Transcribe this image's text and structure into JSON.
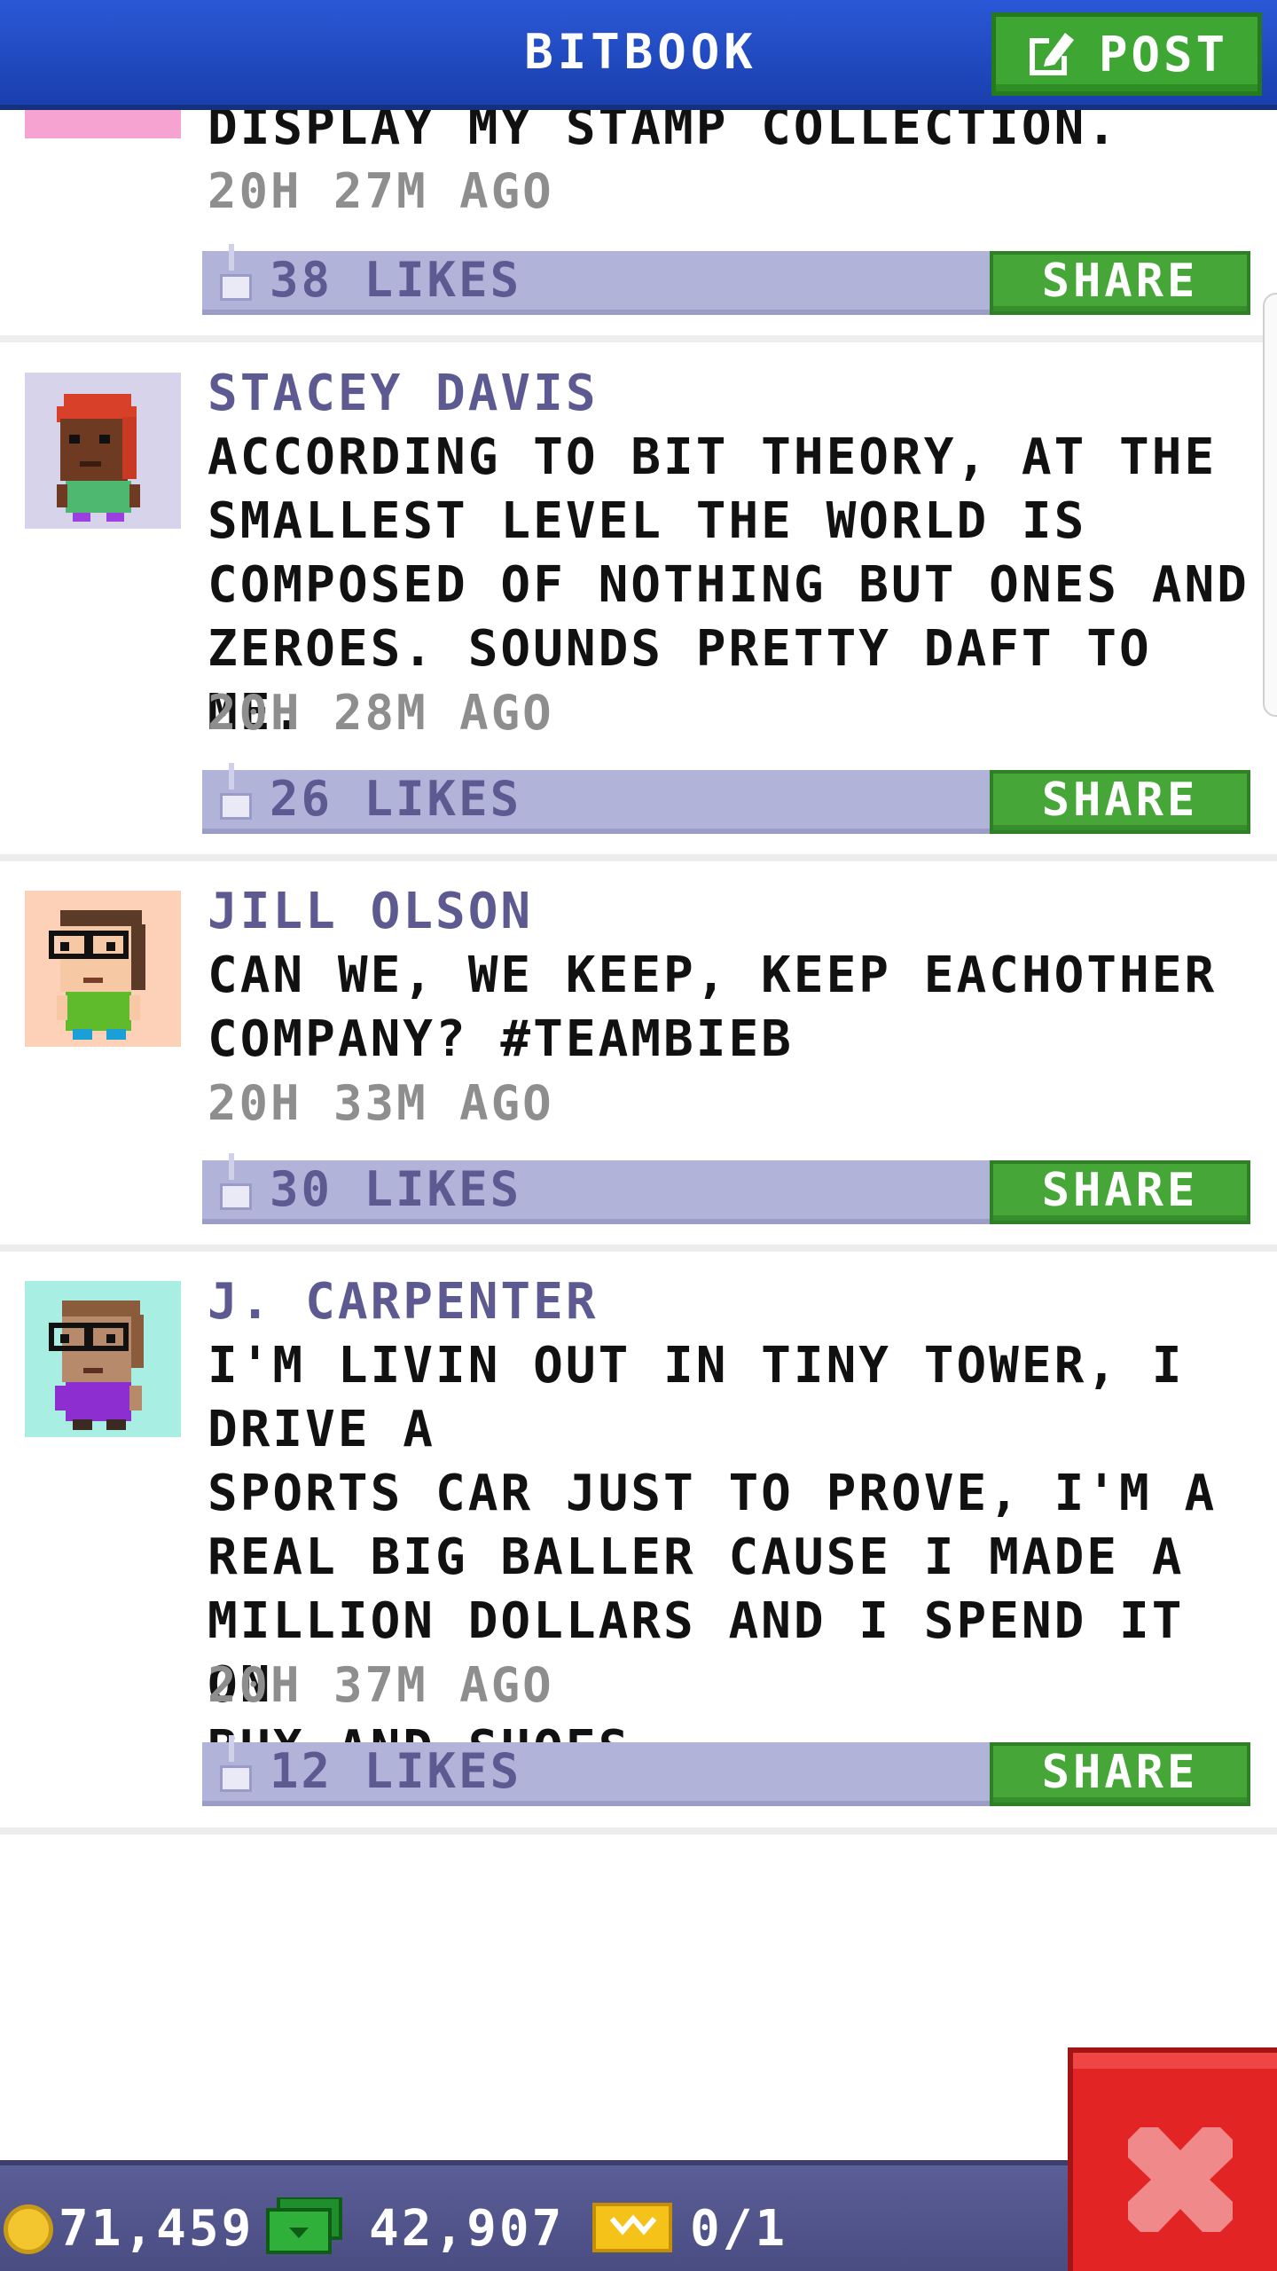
{
  "header": {
    "title": "BITBOOK",
    "post_label": "POST"
  },
  "colors": {
    "header_blue": "#2a58d6",
    "button_green": "#46a638",
    "likes_bar": "#b2b3d9",
    "author_purple": "#5d5a92",
    "close_red": "#e22424",
    "bottom_bar": "#4a4d82"
  },
  "posts": [
    {
      "author": "",
      "message": "DISPLAY MY STAMP COLLECTION.",
      "time": "20H 27M AGO",
      "likes": "38 LIKES",
      "share_label": "SHARE",
      "avatar_bg": "#f7a3d1"
    },
    {
      "author": "STACEY DAVIS",
      "message": "ACCORDING TO BIT THEORY, AT THE\nSMALLEST LEVEL THE WORLD IS\nCOMPOSED OF NOTHING BUT ONES AND\nZEROES. SOUNDS PRETTY DAFT TO ME.",
      "time": "20H 28M AGO",
      "likes": "26 LIKES",
      "share_label": "SHARE",
      "avatar_bg": "#d6d3ea"
    },
    {
      "author": "JILL OLSON",
      "message": "CAN WE, WE KEEP, KEEP EACHOTHER\nCOMPANY? #TEAMBIEB",
      "time": "20H 33M AGO",
      "likes": "30 LIKES",
      "share_label": "SHARE",
      "avatar_bg": "#fdd0b8"
    },
    {
      "author": "J. CARPENTER",
      "message": "I'M LIVIN OUT IN TINY TOWER, I DRIVE A\nSPORTS CAR JUST TO PROVE, I'M A\nREAL BIG BALLER CAUSE I MADE A\nMILLION DOLLARS AND I SPEND IT ON\nBUX AND SHOES.",
      "time": "20H 37M AGO",
      "likes": "12 LIKES",
      "share_label": "SHARE",
      "avatar_bg": "#a8eee2"
    }
  ],
  "status": {
    "coins": "71,459",
    "bux": "42,907",
    "tickets": "0/1"
  },
  "icons": {
    "post": "edit-icon",
    "like": "thumbs-up-icon",
    "coin": "coin-icon",
    "bux": "bux-icon",
    "ticket": "ticket-icon",
    "close": "close-icon"
  }
}
